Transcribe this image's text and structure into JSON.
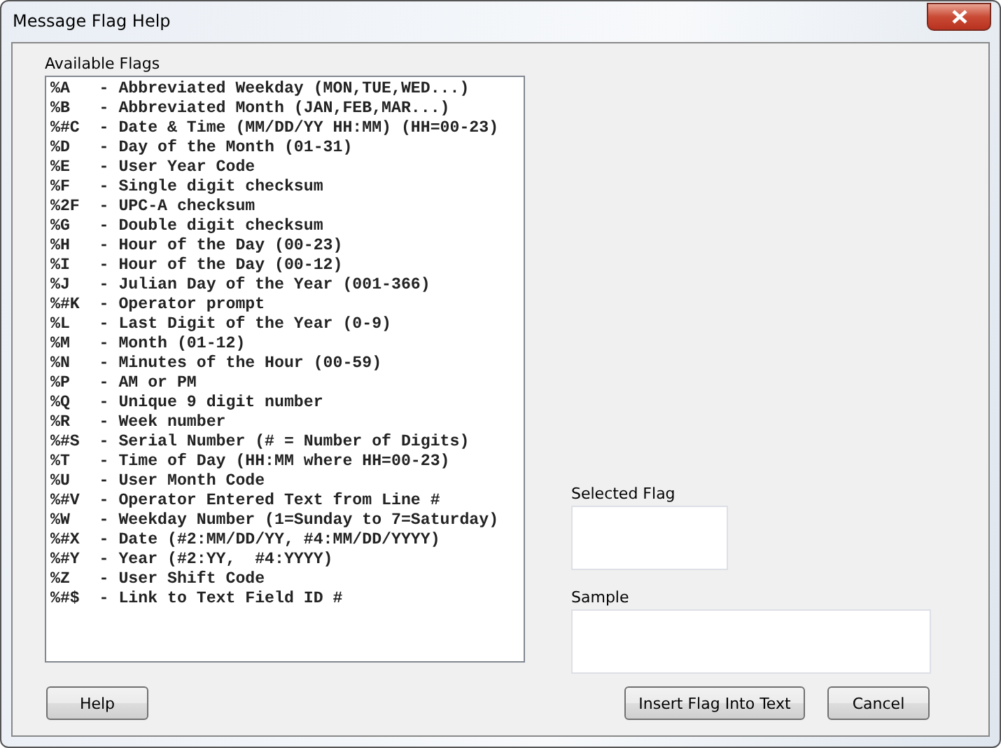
{
  "window": {
    "title": "Message Flag Help"
  },
  "available_flags": {
    "label": "Available Flags",
    "items": [
      "%A   - Abbreviated Weekday (MON,TUE,WED...)",
      "%B   - Abbreviated Month (JAN,FEB,MAR...)",
      "%#C  - Date & Time (MM/DD/YY HH:MM) (HH=00-23)",
      "%D   - Day of the Month (01-31)",
      "%E   - User Year Code",
      "%F   - Single digit checksum",
      "%2F  - UPC-A checksum",
      "%G   - Double digit checksum",
      "%H   - Hour of the Day (00-23)",
      "%I   - Hour of the Day (00-12)",
      "%J   - Julian Day of the Year (001-366)",
      "%#K  - Operator prompt",
      "%L   - Last Digit of the Year (0-9)",
      "%M   - Month (01-12)",
      "%N   - Minutes of the Hour (00-59)",
      "%P   - AM or PM",
      "%Q   - Unique 9 digit number",
      "%R   - Week number",
      "%#S  - Serial Number (# = Number of Digits)",
      "%T   - Time of Day (HH:MM where HH=00-23)",
      "%U   - User Month Code",
      "%#V  - Operator Entered Text from Line #",
      "%W   - Weekday Number (1=Sunday to 7=Saturday)",
      "%#X  - Date (#2:MM/DD/YY, #4:MM/DD/YYYY)",
      "%#Y  - Year (#2:YY,  #4:YYYY)",
      "%Z   - User Shift Code",
      "%#$  - Link to Text Field ID #"
    ]
  },
  "selected_flag": {
    "label": "Selected Flag"
  },
  "sample": {
    "label": "Sample"
  },
  "buttons": {
    "help": "Help",
    "insert": "Insert Flag Into Text",
    "cancel": "Cancel"
  }
}
